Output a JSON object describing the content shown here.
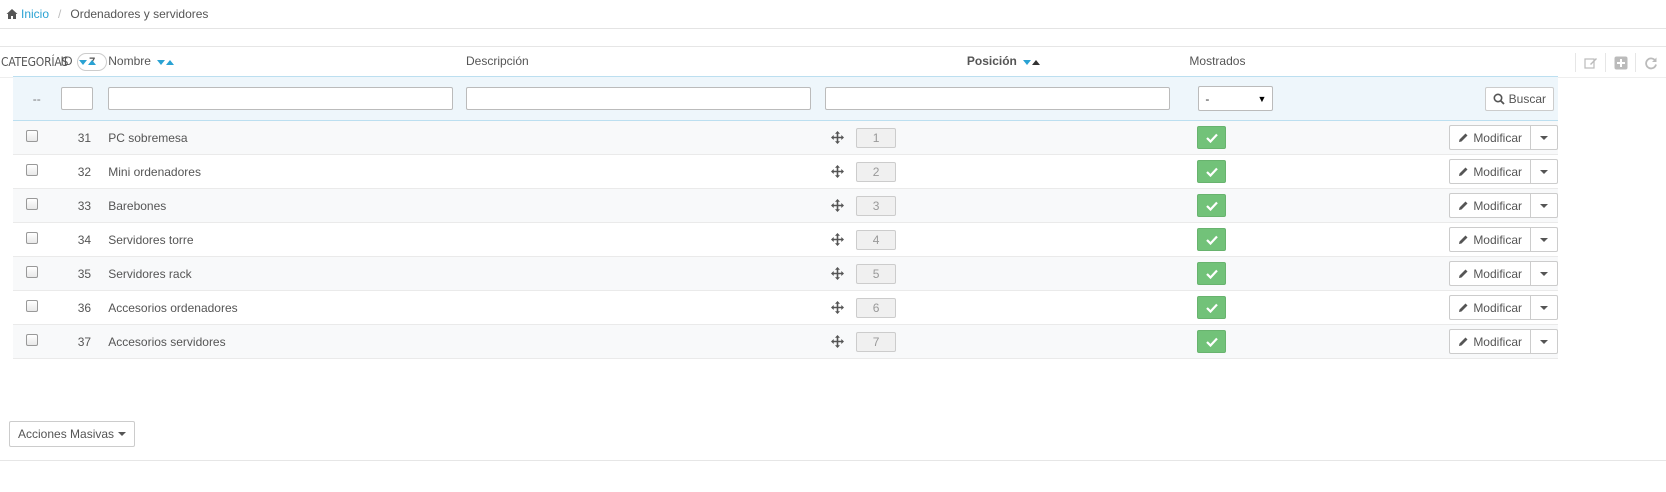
{
  "breadcrumb": {
    "home": "Inicio",
    "separator": "/",
    "current": "Ordenadores y servidores"
  },
  "panel": {
    "title": "CATEGORÍAS",
    "count": "7"
  },
  "columns": {
    "id": "ID",
    "name": "Nombre",
    "description": "Descripción",
    "position": "Posición",
    "shown": "Mostrados"
  },
  "filter": {
    "bulk_placeholder": "--",
    "shown_select": "-",
    "search_button": "Buscar"
  },
  "rows": [
    {
      "id": "31",
      "name": "PC sobremesa",
      "position": "1"
    },
    {
      "id": "32",
      "name": "Mini ordenadores",
      "position": "2"
    },
    {
      "id": "33",
      "name": "Barebones",
      "position": "3"
    },
    {
      "id": "34",
      "name": "Servidores torre",
      "position": "4"
    },
    {
      "id": "35",
      "name": "Servidores rack",
      "position": "5"
    },
    {
      "id": "36",
      "name": "Accesorios ordenadores",
      "position": "6"
    },
    {
      "id": "37",
      "name": "Accesorios servidores",
      "position": "7"
    }
  ],
  "row_action": "Modificar",
  "bulk_actions": "Acciones Masivas",
  "colors": {
    "accent": "#2aa2d3",
    "enabled": "#72c279"
  },
  "icons": {
    "home": "home-icon",
    "edit": "pencil-icon",
    "move": "move-icon",
    "check": "check-icon",
    "search": "search-icon"
  }
}
